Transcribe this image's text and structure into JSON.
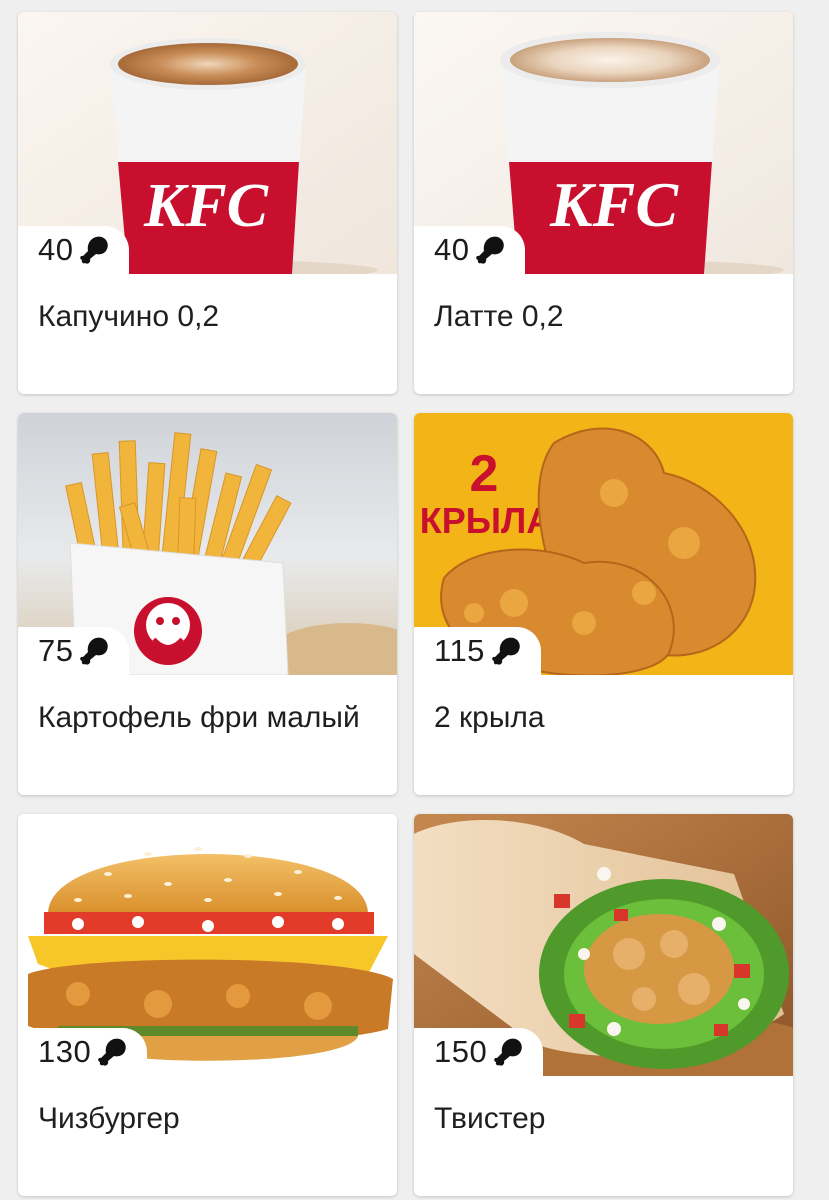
{
  "products": [
    {
      "title": "Капучино 0,2",
      "price": "40",
      "icon": "drumstick-icon"
    },
    {
      "title": "Латте 0,2",
      "price": "40",
      "icon": "drumstick-icon"
    },
    {
      "title": "Картофель фри малый",
      "price": "75",
      "icon": "drumstick-icon"
    },
    {
      "title": "2 крыла",
      "price": "115",
      "icon": "drumstick-icon",
      "image_text": {
        "line1": "2",
        "line2": "КРЫЛА"
      }
    },
    {
      "title": "Чизбургер",
      "price": "130",
      "icon": "drumstick-icon"
    },
    {
      "title": "Твистер",
      "price": "150",
      "icon": "drumstick-icon"
    }
  ],
  "brand": {
    "logo_text": "KFC",
    "red": "#c8102e",
    "yellow": "#f2b417"
  }
}
